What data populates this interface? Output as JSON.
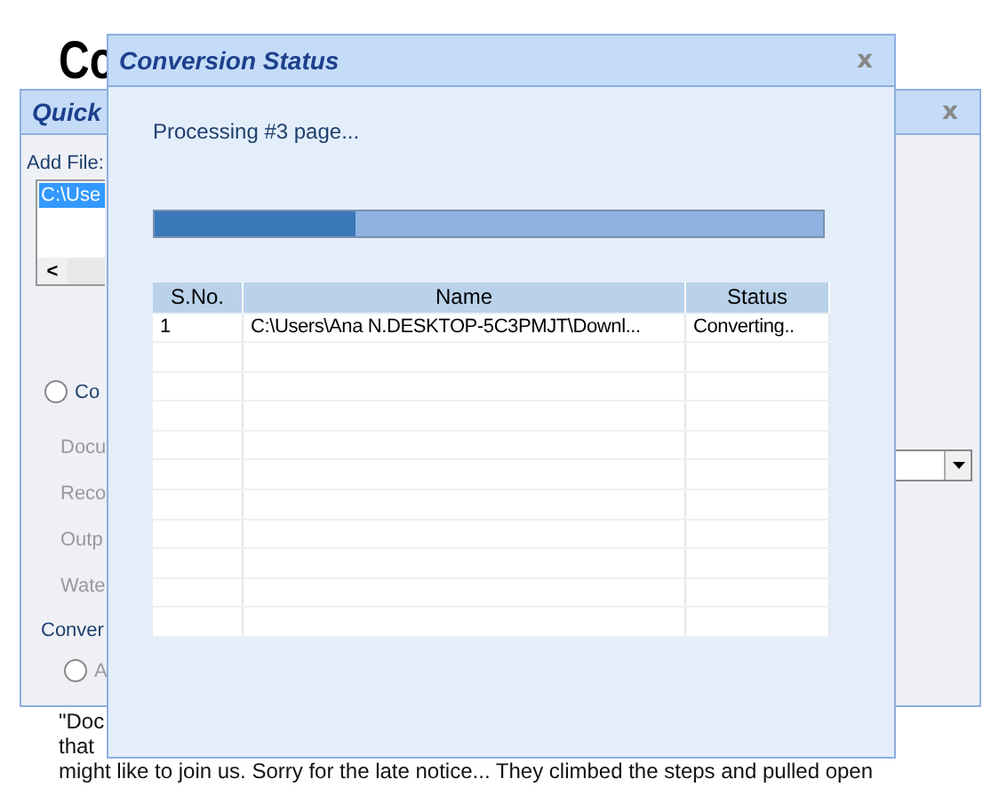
{
  "document": {
    "heading": "Co",
    "lines": [
      "\"Doc",
      "that",
      "might like to join us.  Sorry for the late notice...  They climbed the steps and pulled open"
    ]
  },
  "back_window": {
    "title": "Quick",
    "close": "x",
    "add_file_label": "Add File:",
    "files": [
      {
        "name": "C:\\Use",
        "selected": true
      }
    ],
    "scroll_left": "<",
    "mode_option": {
      "label": "Co",
      "selected": false
    },
    "fields": [
      "Docu",
      "Reco",
      "Outp",
      "Wate"
    ],
    "section_label": "Conver",
    "section_option": {
      "label": "A",
      "selected": false
    }
  },
  "dialog": {
    "title": "Conversion Status",
    "close": "x",
    "message": "Processing #3 page...",
    "progress": {
      "level": 0.3
    },
    "table": {
      "columns": [
        "S.No.",
        "Name",
        "Status"
      ],
      "rows": [
        {
          "cells": [
            "1",
            "C:\\Users\\Ana N.DESKTOP-5C3PMJT\\Downl...",
            "Converting.."
          ]
        }
      ]
    }
  }
}
